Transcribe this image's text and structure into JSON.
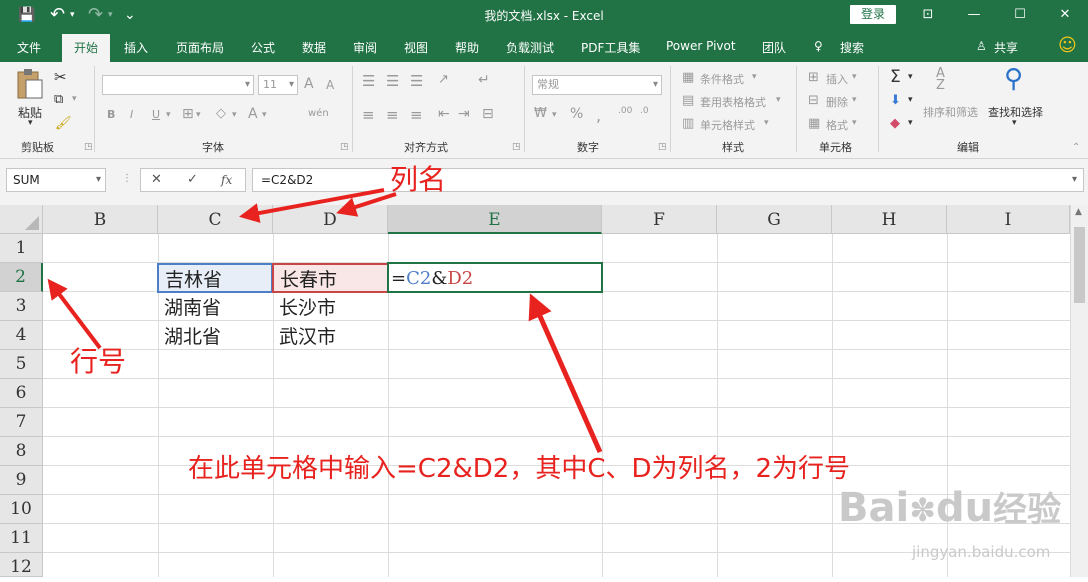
{
  "window": {
    "title": "我的文档.xlsx  -  Excel",
    "login_label": "登录",
    "minimize": "—",
    "maximize": "☐",
    "close": "✕",
    "restore_ribbon": "⊡"
  },
  "quick_access": {
    "save": "💾",
    "undo": "↶",
    "redo": "↷",
    "customize": "⌄"
  },
  "tabs": [
    "文件",
    "开始",
    "插入",
    "页面布局",
    "公式",
    "数据",
    "审阅",
    "视图",
    "帮助",
    "负载测试",
    "PDF工具集",
    "Power Pivot",
    "团队",
    "搜索"
  ],
  "tab_tell": "♀",
  "share_label": "共享",
  "emoji": "☺",
  "ribbon": {
    "clipboard": {
      "label": "剪贴板",
      "paste": "粘贴"
    },
    "font": {
      "label": "字体",
      "size": "11",
      "bold": "B",
      "italic": "I",
      "underline": "U",
      "grow": "A",
      "shrink": "A",
      "color": "A",
      "wen": "wén"
    },
    "alignment": {
      "label": "对齐方式"
    },
    "number": {
      "label": "数字",
      "format": "常规",
      "percent": "%",
      "comma": ","
    },
    "styles": {
      "label": "样式",
      "cond": "条件格式",
      "table": "套用表格格式",
      "cell": "单元格样式"
    },
    "cells": {
      "label": "单元格",
      "insert": "插入",
      "delete": "删除",
      "format": "格式"
    },
    "editing": {
      "label": "编辑",
      "sum": "Σ",
      "sort": "排序和筛选",
      "find": "查找和选择",
      "sortA": "A",
      "sortZ": "Z"
    }
  },
  "formula_bar": {
    "name_box": "SUM",
    "cancel": "✕",
    "enter": "✓",
    "fx": "fx",
    "formula": "=C2&D2"
  },
  "columns": [
    "B",
    "C",
    "D",
    "E",
    "F",
    "G",
    "H",
    "I"
  ],
  "rows": [
    "1",
    "2",
    "3",
    "4",
    "5",
    "6",
    "7",
    "8",
    "9",
    "10",
    "11",
    "12"
  ],
  "cells": {
    "C2": "吉林省",
    "D2": "长春市",
    "C3": "湖南省",
    "D3": "长沙市",
    "C4": "湖北省",
    "D4": "武汉市",
    "E2": {
      "eq": "=",
      "c": "C2",
      "amp": "&",
      "d": "D2"
    }
  },
  "annotations": {
    "colname": "列名",
    "rowno": "行号",
    "note": "在此单元格中输入=C2&D2，其中C、D为列名，2为行号"
  },
  "watermark": {
    "brand": "Bai",
    "du": "du",
    "site": "经验",
    "url": "jingyan.baidu.com"
  },
  "colors": {
    "excel_green": "#217346",
    "annotation_red": "#e8231f",
    "ref_blue": "#4d7ec6",
    "ref_red": "#c84646"
  }
}
